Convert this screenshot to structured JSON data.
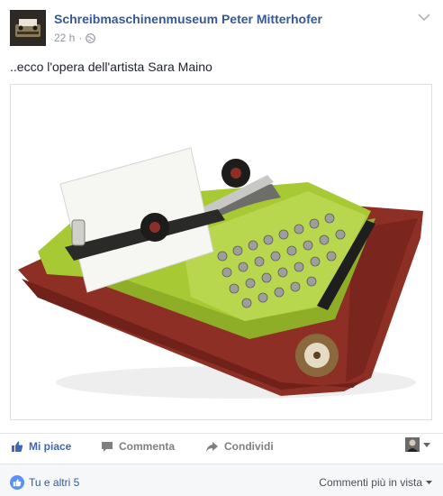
{
  "post": {
    "page_name": "Schreibmaschinenmuseum Peter Mitterhofer",
    "time": "22 h",
    "separator": "·",
    "privacy_icon": "globe-icon",
    "text": "..ecco l'opera dell'artista Sara Maino",
    "image": {
      "subject": "typewriter-artwork",
      "colors": {
        "body": "#a6c934",
        "case": "#8e2f25",
        "paper": "#f6f6f3"
      }
    }
  },
  "actions": {
    "like_label": "Mi piace",
    "comment_label": "Commenta",
    "share_label": "Condividi"
  },
  "footer": {
    "reactions_text": "Tu e altri 5",
    "sort_label": "Commenti più in vista"
  },
  "colors": {
    "link": "#365899",
    "like_blue": "#4267b2",
    "muted": "#90949c"
  }
}
